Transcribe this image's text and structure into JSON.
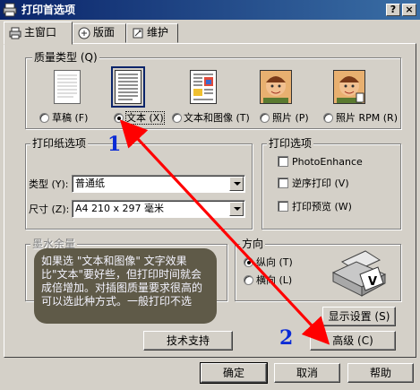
{
  "window": {
    "title": "打印首选项",
    "help_btn": "?",
    "close_btn": "×"
  },
  "tabs": [
    {
      "label": "主窗口",
      "icon": "printer-icon"
    },
    {
      "label": "版面",
      "icon": "layout-icon"
    },
    {
      "label": "维护",
      "icon": "maintenance-icon"
    }
  ],
  "quality": {
    "group_label": "质量类型 (Q)",
    "options": [
      {
        "label": "草稿 (F)",
        "selected": false,
        "icon": "draft-page-icon"
      },
      {
        "label": "文本 (X)",
        "selected": true,
        "icon": "text-page-icon"
      },
      {
        "label": "文本和图像 (T)",
        "selected": false,
        "icon": "text-image-page-icon"
      },
      {
        "label": "照片 (P)",
        "selected": false,
        "icon": "photo-icon"
      },
      {
        "label": "照片 RPM (R)",
        "selected": false,
        "icon": "photo-rpm-icon"
      }
    ]
  },
  "paper": {
    "group_label": "打印纸选项",
    "type_label": "类型 (Y):",
    "type_value": "普通纸",
    "size_label": "尺寸 (Z):",
    "size_value": "A4 210 x 297 毫米"
  },
  "print_options": {
    "group_label": "打印选项",
    "items": [
      {
        "label": "PhotoEnhance",
        "checked": false
      },
      {
        "label": "逆序打印 (V)",
        "checked": false
      },
      {
        "label": "打印预览 (W)",
        "checked": false
      }
    ]
  },
  "ink": {
    "group_label": "墨水余量"
  },
  "orientation": {
    "group_label": "方向",
    "options": [
      {
        "label": "纵向 (T)",
        "selected": true
      },
      {
        "label": "横向 (L)",
        "selected": false
      }
    ]
  },
  "buttons": {
    "display_settings": "显示设置 (S)",
    "advanced": "高级 (C)",
    "tech_support": "技术支持",
    "ok": "确定",
    "cancel": "取消",
    "help": "帮助"
  },
  "annotation": {
    "note": "如果选 \"文本和图像\" 文字效果比\"文本\"要好些，但打印时间就会成倍增加。对插图质量要求很高的可以选此种方式。一般打印不选",
    "mark1": "1",
    "mark2": "2",
    "arrow_color": "#ff0000",
    "mark_color": "#0b2bd6"
  }
}
